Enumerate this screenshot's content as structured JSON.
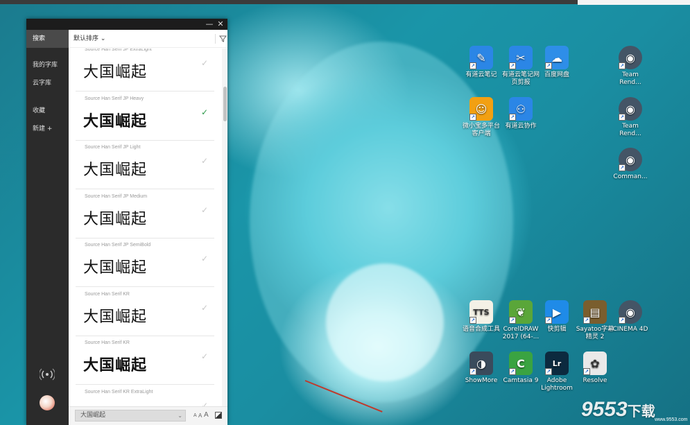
{
  "app": {
    "sidebar": {
      "search": "搜索",
      "my_library": "我的字库",
      "cloud_library": "云字库",
      "favorites": "收藏",
      "new": "新建 +"
    },
    "toolbar": {
      "sort_label": "默认排序",
      "sort_chevron": "⌄"
    },
    "window_buttons": {
      "minimize": "—",
      "close": "✕"
    },
    "fonts": [
      {
        "name": "Source Han Serif JP ExtraLight",
        "sample": "大国崛起",
        "checked": false,
        "weight": "200"
      },
      {
        "name": "Source Han Serif JP Heavy",
        "sample": "大国崛起",
        "checked": true,
        "weight": "900"
      },
      {
        "name": "Source Han Serif JP Light",
        "sample": "大国崛起",
        "checked": false,
        "weight": "300"
      },
      {
        "name": "Source Han Serif JP Medium",
        "sample": "大国崛起",
        "checked": false,
        "weight": "500"
      },
      {
        "name": "Source Han Serif JP SemiBold",
        "sample": "大国崛起",
        "checked": false,
        "weight": "600"
      },
      {
        "name": "Source Han Serif KR",
        "sample": "大国崛起",
        "checked": false,
        "weight": "400"
      },
      {
        "name": "Source Han Serif KR",
        "sample": "大国崛起",
        "checked": false,
        "weight": "700"
      },
      {
        "name": "Source Han Serif KR ExtraLight",
        "sample": "",
        "checked": false,
        "weight": "200"
      }
    ],
    "bottom": {
      "preview_text": "大国崛起",
      "size_small": "A",
      "size_medium": "A",
      "size_large": "A"
    }
  },
  "desktop_icons": [
    {
      "label": "有道云笔记",
      "color": "#2b86e6",
      "glyph": "✎"
    },
    {
      "label": "有道云笔记网页剪报",
      "color": "#2b86e6",
      "glyph": "✂"
    },
    {
      "label": "百度网盘",
      "color": "#2e8ee8",
      "glyph": "☁"
    },
    {
      "label": "Team Rend...",
      "color": "#445566",
      "glyph": "◉"
    },
    {
      "label": "微小宝多平台客户端",
      "color": "#f2a012",
      "glyph": "☺"
    },
    {
      "label": "有道云协作",
      "color": "#2b86e6",
      "glyph": "⚇"
    },
    {
      "label": "Team Rend...",
      "color": "#445566",
      "glyph": "◉"
    },
    {
      "label": "Comman...",
      "color": "#445566",
      "glyph": "◉"
    },
    {
      "label": "语音合成工具",
      "color": "#f4f1e6",
      "glyph": "TTS"
    },
    {
      "label": "CorelDRAW 2017 (64-...",
      "color": "#5aa639",
      "glyph": "❦"
    },
    {
      "label": "快剪辑",
      "color": "#1f8be8",
      "glyph": "▶"
    },
    {
      "label": "Sayatoo字幕精灵 2",
      "color": "#7a5e2e",
      "glyph": "▤"
    },
    {
      "label": "CINEMA 4D",
      "color": "#445566",
      "glyph": "◉"
    },
    {
      "label": "ShowMore",
      "color": "#3a4b5c",
      "glyph": "◑"
    },
    {
      "label": "Camtasia 9",
      "color": "#3aa341",
      "glyph": "C"
    },
    {
      "label": "Adobe Lightroom",
      "color": "#0c2a3f",
      "glyph": "Lr"
    },
    {
      "label": "Resolve",
      "color": "#e9e9e9",
      "glyph": "✿"
    }
  ],
  "watermark": {
    "text": "9553",
    "suffix": "下载",
    "url": "www.9553.com"
  }
}
